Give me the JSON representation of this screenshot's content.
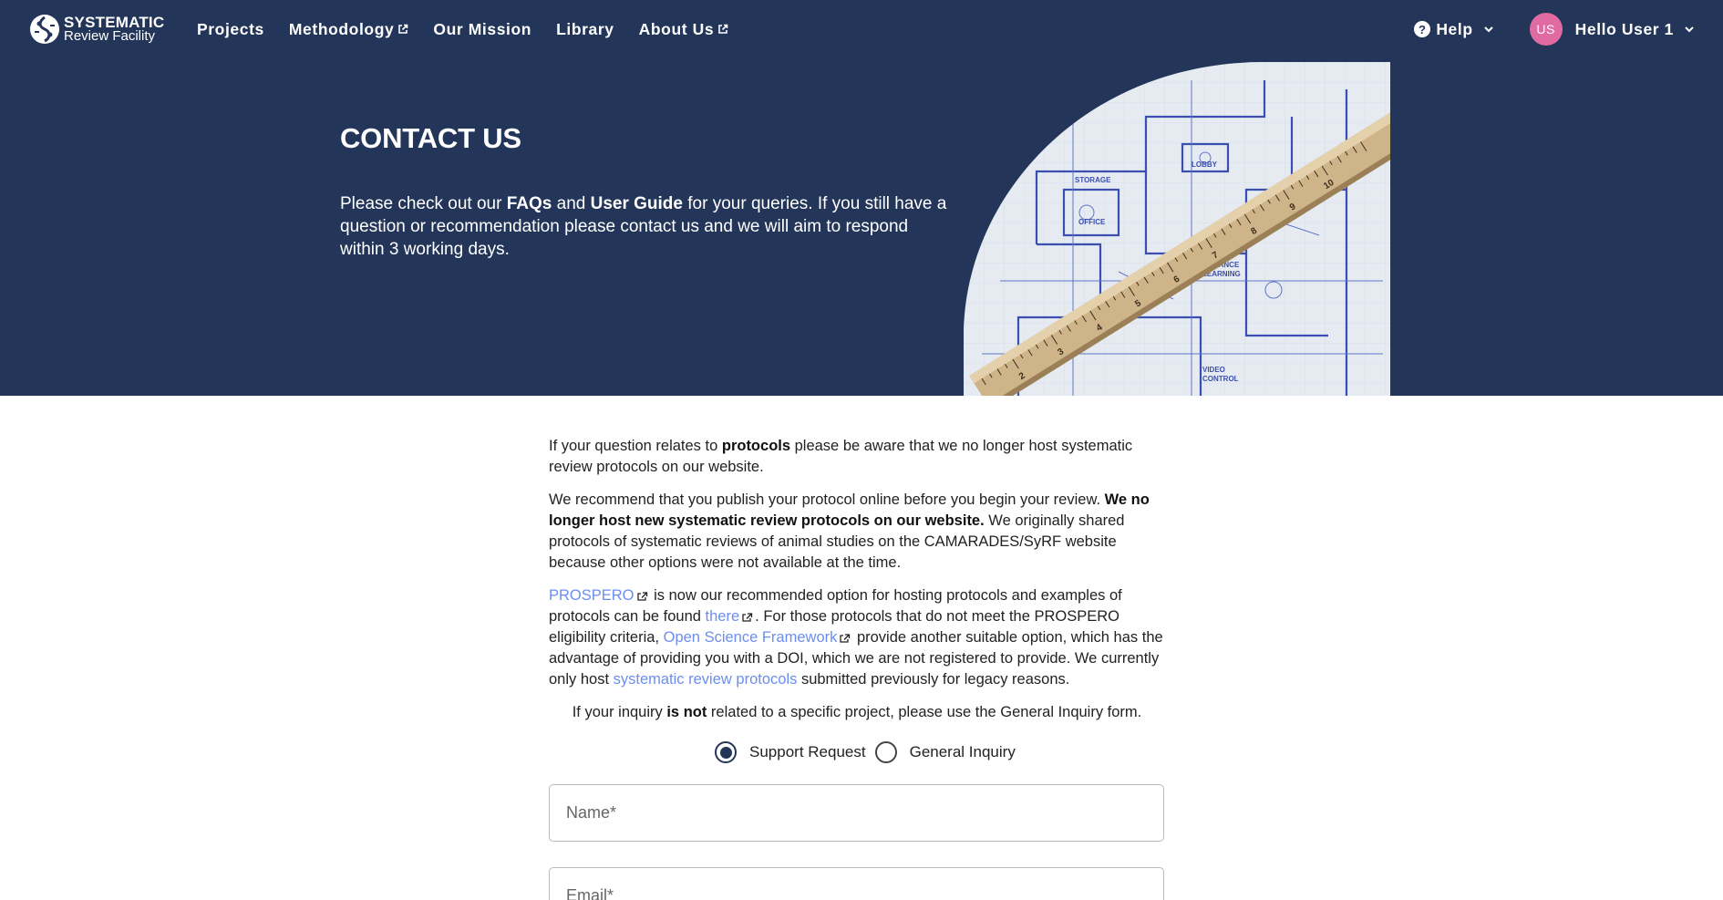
{
  "nav": {
    "logo_line1": "SYSTEMATIC",
    "logo_line2": "Review Facility",
    "links": [
      {
        "label": "Projects",
        "external": false
      },
      {
        "label": "Methodology",
        "external": true
      },
      {
        "label": "Our Mission",
        "external": false
      },
      {
        "label": "Library",
        "external": false
      },
      {
        "label": "About Us",
        "external": true
      }
    ],
    "help_label": "Help",
    "help_icon": "?",
    "avatar_initials": "US",
    "user_greeting": "Hello User 1"
  },
  "hero": {
    "title": "CONTACT US",
    "text_before_faqs": "Please check out our ",
    "faqs": "FAQs",
    "text_and": " and ",
    "user_guide": "User Guide",
    "text_after": " for your queries. If you still have a question or recommendation please contact us and we will aim to respond within 3 working days."
  },
  "content": {
    "p1_a": "If your question relates to ",
    "p1_b": "protocols",
    "p1_c": " please be aware that we no longer host systematic review protocols on our website.",
    "p2_a": "We recommend that you publish your protocol online before you begin your review. ",
    "p2_b": "We no longer host new systematic review protocols on our website.",
    "p2_c": " We originally shared protocols of systematic reviews of animal studies on the CAMARADES/SyRF website because other options were not available at the time.",
    "p3_link1": "PROSPERO",
    "p3_a": " is now our recommended option for hosting protocols and examples of protocols can be found ",
    "p3_link2": "there",
    "p3_b": ". For those protocols that do not meet the PROSPERO eligibility criteria, ",
    "p3_link3": "Open Science Framework",
    "p3_c": " provide another suitable option, which has the advantage of providing you with a DOI, which we are not registered to provide. We currently only host ",
    "p3_link4": "systematic review protocols",
    "p3_d": " submitted previously for legacy reasons.",
    "note_a": "If your inquiry ",
    "note_b": "is not",
    "note_c": " related to a specific project, please use the General Inquiry form."
  },
  "form": {
    "radio_options": [
      {
        "label": "Support Request",
        "checked": true
      },
      {
        "label": "General Inquiry",
        "checked": false
      }
    ],
    "name_placeholder": "Name*",
    "email_placeholder": "Email*"
  },
  "colors": {
    "header_bg": "#233558",
    "link": "#6c8ef0",
    "avatar_bg": "#e06aa2"
  }
}
